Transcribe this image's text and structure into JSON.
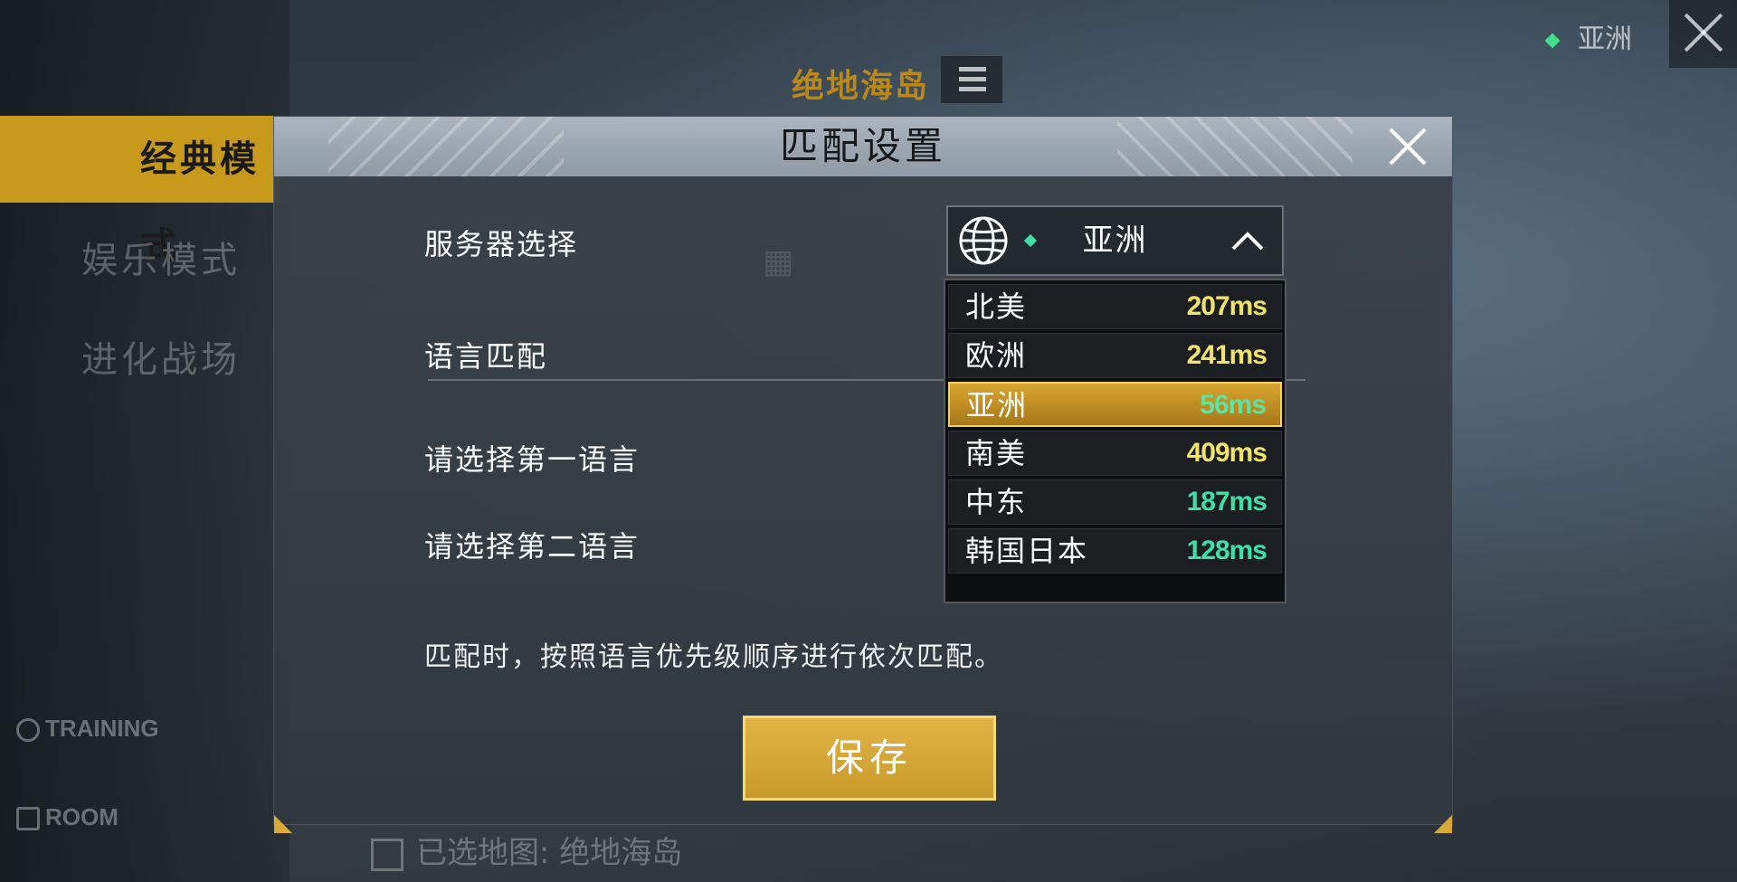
{
  "background": {
    "modes": [
      "经典模式",
      "娱乐模式",
      "进化战场"
    ],
    "links": [
      "TRAINING",
      "ROOM"
    ],
    "map_title": "绝地海岛",
    "region": "亚洲",
    "selected_map": "已选地图: 绝地海岛"
  },
  "modal": {
    "title": "匹配设置",
    "labels": {
      "server": "服务器选择",
      "language_match": "语言匹配",
      "first_language": "请选择第一语言",
      "second_language": "请选择第二语言"
    },
    "hint": "匹配时，按照语言优先级顺序进行依次匹配。",
    "save_label": "保存"
  },
  "server_select": {
    "selected": "亚洲",
    "expanded": true,
    "options": [
      {
        "name": "北美",
        "ping": "207ms",
        "color": "#f2e46a"
      },
      {
        "name": "欧洲",
        "ping": "241ms",
        "color": "#f2e46a"
      },
      {
        "name": "亚洲",
        "ping": "56ms",
        "color": "#5fe3a0",
        "active": true
      },
      {
        "name": "南美",
        "ping": "409ms",
        "color": "#f2e46a"
      },
      {
        "name": "中东",
        "ping": "187ms",
        "color": "#3ee0a6"
      },
      {
        "name": "韩国日本",
        "ping": "128ms",
        "color": "#3ee0a6"
      }
    ]
  },
  "icons": [
    "globe-icon",
    "chevron-up-icon",
    "close-icon",
    "list-icon",
    "training-icon",
    "home-icon",
    "checkbox-icon"
  ]
}
